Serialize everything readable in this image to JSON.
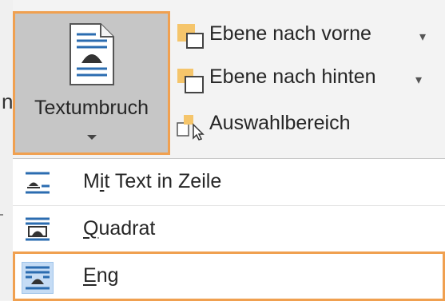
{
  "ribbon": {
    "wrap_button": {
      "label": "Textumbruch",
      "icon": "text-wrap-icon",
      "highlight_color": "#f0a050"
    },
    "bring_forward": {
      "label": "Ebene nach vorne",
      "icon": "bring-forward-icon"
    },
    "send_backward": {
      "label": "Ebene nach hinten",
      "icon": "send-backward-icon"
    },
    "selection_pane": {
      "label": "Auswahlbereich",
      "icon": "selection-pane-icon"
    }
  },
  "menu": {
    "items": [
      {
        "pre": "M",
        "accel": "i",
        "post": "t Text in Zeile",
        "icon": "inline-with-text-icon",
        "selected": false
      },
      {
        "pre": "",
        "accel": "Q",
        "post": "uadrat",
        "icon": "square-wrap-icon",
        "selected": false
      },
      {
        "pre": "",
        "accel": "E",
        "post": "ng",
        "icon": "tight-wrap-icon",
        "selected": true
      }
    ]
  },
  "colors": {
    "accent": "#f0a050",
    "selection": "#c5dcf5",
    "icon_blue": "#2b6cb0"
  }
}
